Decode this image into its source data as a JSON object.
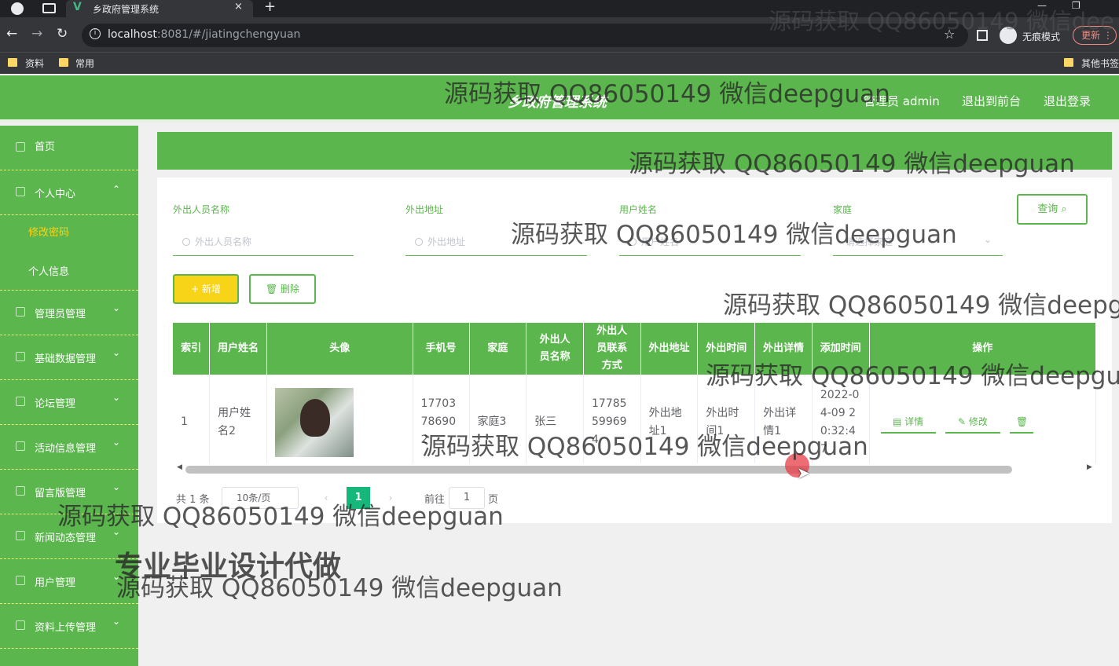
{
  "browser": {
    "tab_title": "乡政府管理系统",
    "tab_close": "×",
    "tab_new": "+",
    "win_min": "—",
    "win_restore": "❐",
    "back": "←",
    "forward": "→",
    "reload": "↻",
    "url_host": "localhost",
    "url_rest": ":8081/#/jiatingchengyuan",
    "star": "☆",
    "incognito_label": "无痕模式",
    "update_label": "更新",
    "menu_dots": "⋮",
    "bookmarks": [
      "资料",
      "常用"
    ],
    "other_bookmarks": "其他书签"
  },
  "header": {
    "title": "乡政府管理系统",
    "admin_label": "管理员 admin",
    "to_front": "退出到前台",
    "logout": "退出登录"
  },
  "sidebar": {
    "items": [
      {
        "label": "首页"
      },
      {
        "label": "个人中心",
        "expanded": true
      },
      {
        "label": "管理员管理"
      },
      {
        "label": "基础数据管理"
      },
      {
        "label": "论坛管理"
      },
      {
        "label": "活动信息管理"
      },
      {
        "label": "留言版管理"
      },
      {
        "label": "新闻动态管理"
      },
      {
        "label": "用户管理"
      },
      {
        "label": "资料上传管理"
      }
    ],
    "sub_items": [
      "修改密码",
      "个人信息"
    ],
    "chevron": "⌄",
    "chevron_up": "⌃"
  },
  "search": {
    "fields": [
      {
        "label": "外出人员名称",
        "placeholder": "外出人员名称"
      },
      {
        "label": "外出地址",
        "placeholder": "外出地址"
      },
      {
        "label": "用户姓名",
        "placeholder": "用户姓名"
      },
      {
        "label": "家庭",
        "placeholder": "请选择家庭"
      }
    ],
    "query_button": "查询 ⌕"
  },
  "actions": {
    "add": "+ 新增",
    "delete": "🗑 删除"
  },
  "table": {
    "columns": [
      "索引",
      "用户姓名",
      "头像",
      "手机号",
      "家庭",
      "外出人员名称",
      "外出人员联系方式",
      "外出地址",
      "外出时间",
      "外出详情",
      "添加时间",
      "操作"
    ],
    "rows": [
      {
        "index": "1",
        "user_name": "用户姓名2",
        "phone": "17703786902",
        "family": "家庭3",
        "out_name": "张三",
        "out_contact": "17785599694",
        "out_address": "外出地址1",
        "out_time": "外出时间1",
        "out_detail": "外出详情1",
        "add_time": "2022-04-09 20:32:47"
      }
    ],
    "op_detail": "▤ 详情",
    "op_edit": "✎ 修改",
    "op_delete": "🗑"
  },
  "pagination": {
    "total": "共 1 条",
    "page_size": "10条/页",
    "prev": "‹",
    "next": "›",
    "current": "1",
    "goto_prefix": "前往",
    "goto_value": "1",
    "goto_suffix": "页"
  },
  "watermarks": {
    "contact": "源码获取 QQ86050149 微信deepguan",
    "contact_cut": "源码获取 QQ86050149 微信dee",
    "service": "专业毕业设计代做"
  }
}
